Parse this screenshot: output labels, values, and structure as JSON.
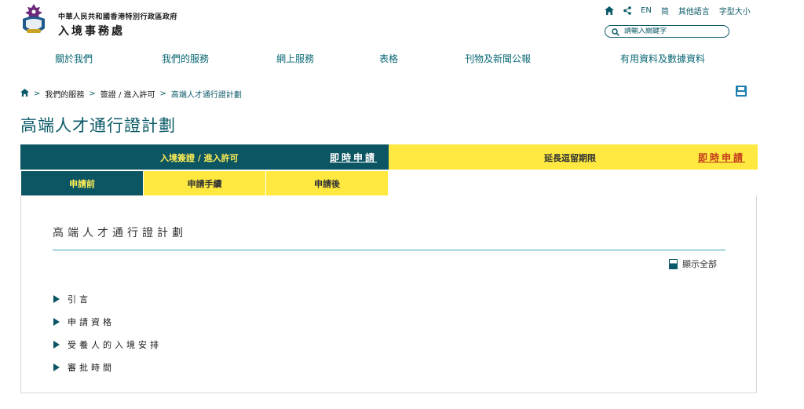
{
  "header": {
    "gov_name": "中華人民共和國香港特別行政區政府",
    "dept_name": "入境事務處",
    "top_links": {
      "en": "EN",
      "simplified": "简",
      "other_lang": "其他語言",
      "font_size": "字型大小"
    },
    "search": {
      "placeholder": "請輸入關鍵字"
    }
  },
  "main_nav": [
    "關於我們",
    "我們的服務",
    "網上服務",
    "表格",
    "刊物及新聞公報",
    "有用資料及數據資料"
  ],
  "breadcrumb": [
    "我們的服務",
    "簽證 / 進入許可",
    "高端人才通行證計劃"
  ],
  "page_title": "高端人才通行證計劃",
  "tabs": {
    "entry_label": "入境簽證 / 進入許可",
    "entry_apply": "即時申請",
    "extend_label": "延長逗留期限",
    "extend_apply": "即時申請",
    "sub": [
      "申請前",
      "申請手續",
      "申請後"
    ]
  },
  "content": {
    "section_title": "高端人才通行證計劃",
    "show_all": "顯示全部",
    "accordion": [
      "引言",
      "申請資格",
      "受養人的入境安排",
      "審批時間"
    ]
  },
  "colors": {
    "primary": "#0c5562",
    "accent_yellow": "#ffe940",
    "apply_red": "#c23a1c"
  }
}
